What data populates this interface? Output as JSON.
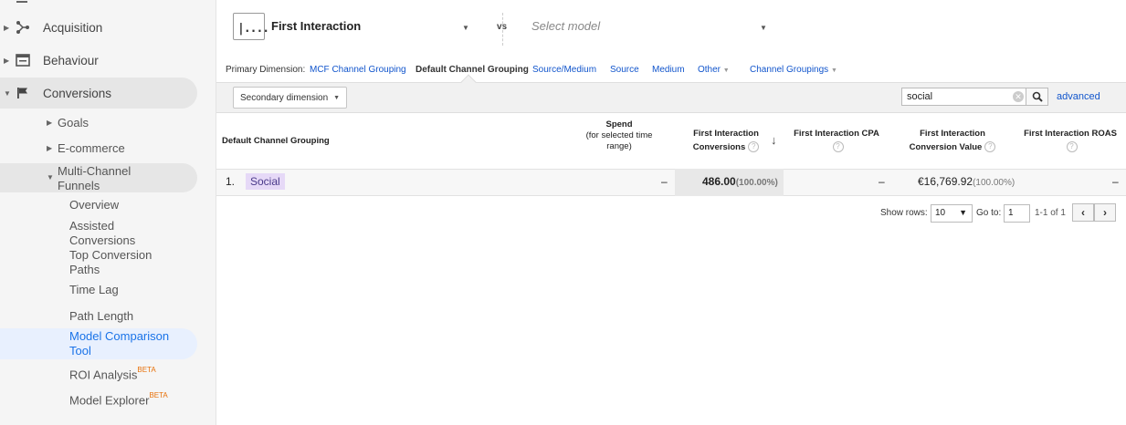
{
  "sidebar": {
    "top_items": [
      {
        "label": "Acquisition",
        "icon": "acquisition-icon"
      },
      {
        "label": "Behaviour",
        "icon": "behaviour-icon"
      },
      {
        "label": "Conversions",
        "icon": "flag-icon"
      }
    ],
    "sub_items": [
      {
        "label": "Goals"
      },
      {
        "label": "E-commerce"
      },
      {
        "label": "Multi-Channel Funnels"
      }
    ],
    "leaf_items": [
      {
        "label": "Overview"
      },
      {
        "label": "Assisted Conversions"
      },
      {
        "label": "Top Conversion Paths"
      },
      {
        "label": "Time Lag"
      },
      {
        "label": "Path Length"
      },
      {
        "label": "Model Comparison Tool"
      },
      {
        "label": "ROI Analysis",
        "badge": "BETA"
      },
      {
        "label": "Model Explorer",
        "badge": "BETA"
      }
    ]
  },
  "header": {
    "model_icon": "|....",
    "model_name": "First Interaction",
    "vs": "vs",
    "select_model_placeholder": "Select model"
  },
  "primary_dimension": {
    "label": "Primary Dimension:",
    "options": [
      "MCF Channel Grouping",
      "Default Channel Grouping",
      "Source/Medium",
      "Source",
      "Medium",
      "Other"
    ],
    "current": "Default Channel Grouping",
    "channel_groupings": "Channel Groupings"
  },
  "toolbar": {
    "secondary_dimension": "Secondary dimension",
    "search_value": "social",
    "advanced": "advanced"
  },
  "table": {
    "headers": {
      "dimension": "Default Channel Grouping",
      "spend": "Spend",
      "spend_sub": "(for selected time range)",
      "conversions": "First Interaction Conversions",
      "cpa": "First Interaction CPA",
      "value": "First Interaction Conversion Value",
      "roas": "First Interaction ROAS"
    },
    "rows": [
      {
        "index": "1.",
        "channel": "Social",
        "spend": "–",
        "conversions": "486.00",
        "conversions_pct": "(100.00%)",
        "cpa": "–",
        "value": "€16,769.92",
        "value_pct": "(100.00%)",
        "roas": "–"
      }
    ]
  },
  "pagination": {
    "show_rows_label": "Show rows:",
    "show_rows_value": "10",
    "goto_label": "Go to:",
    "goto_value": "1",
    "range": "1-1 of 1"
  }
}
